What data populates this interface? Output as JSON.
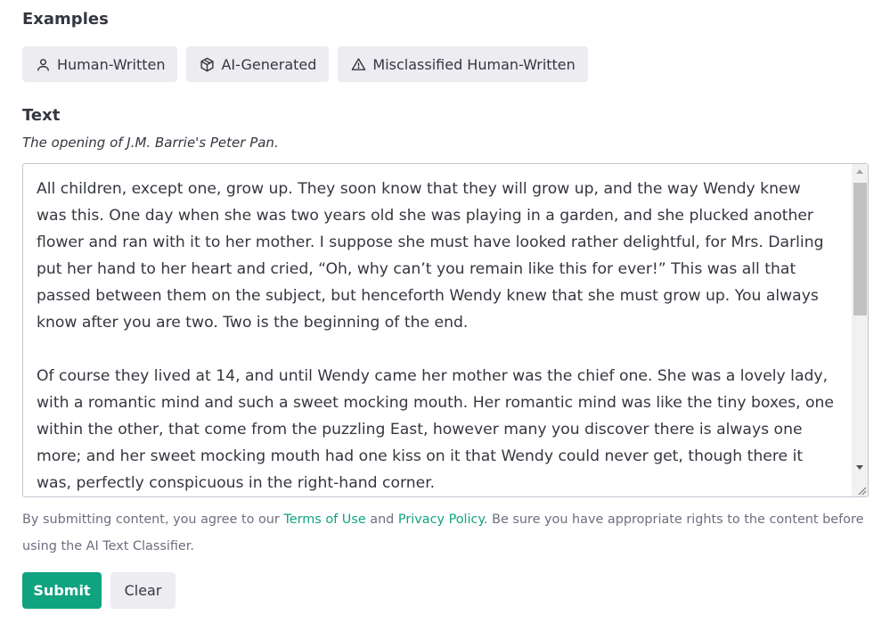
{
  "examples": {
    "heading": "Examples",
    "buttons": [
      {
        "label": "Human-Written",
        "icon": "user-icon"
      },
      {
        "label": "AI-Generated",
        "icon": "cube-icon"
      },
      {
        "label": "Misclassified Human-Written",
        "icon": "warning-icon"
      }
    ]
  },
  "text_section": {
    "heading": "Text",
    "subtitle": "The opening of J.M. Barrie's Peter Pan.",
    "lines_p1": [
      "All children, except one, grow up. They soon know that they will grow up, and the way Wendy knew",
      "was this. One day when she was two years old she was playing in a garden, and she plucked another",
      "flower and ran with it to her mother. I suppose she must have looked rather delightful, for Mrs. Darling",
      "put her hand to her heart and cried, “Oh, why can’t you remain like this for ever!” This was all that",
      "passed between them on the subject, but henceforth Wendy knew that she must grow up. You always",
      "know after you are two. Two is the beginning of the end."
    ],
    "lines_p2": [
      "Of course they lived at 14, and until Wendy came her mother was the chief one. She was a lovely lady,",
      "with a romantic mind and such a sweet mocking mouth. Her romantic mind was like the tiny boxes, one",
      "within the other, that come from the puzzling East, however many you discover there is always one",
      "more; and her sweet mocking mouth had one kiss on it that Wendy could never get, though there it",
      "was, perfectly conspicuous in the right-hand corner."
    ]
  },
  "disclaimer": {
    "prefix": "By submitting content, you agree to our ",
    "terms_link": "Terms of Use",
    "middle": " and ",
    "privacy_link": "Privacy Policy",
    "suffix": ". Be sure you have appropriate rights to the content before using the AI Text Classifier."
  },
  "actions": {
    "submit_label": "Submit",
    "clear_label": "Clear"
  },
  "colors": {
    "accent": "#10a37f",
    "button_bg": "#ececf1",
    "text": "#353740",
    "muted": "#6e6e80"
  }
}
